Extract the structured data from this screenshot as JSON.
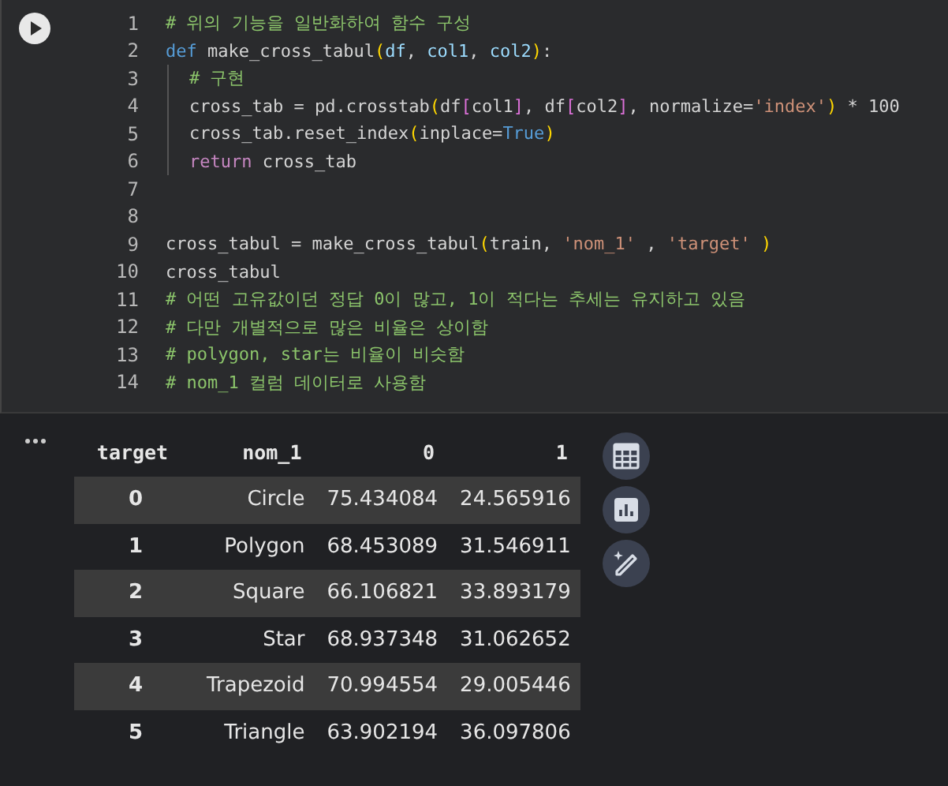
{
  "code_cell": {
    "lines": [
      {
        "number": "1",
        "indented": false,
        "tokens": [
          {
            "t": "# 위의 기능을 일반화하여 함수 구성",
            "kind": "comment"
          }
        ]
      },
      {
        "number": "2",
        "indented": false,
        "tokens": [
          {
            "t": "def",
            "kind": "keyword"
          },
          {
            "t": " make_cross_tabul",
            "kind": "plain"
          },
          {
            "t": "(",
            "kind": "bracket"
          },
          {
            "t": "df",
            "kind": "param"
          },
          {
            "t": ", ",
            "kind": "plain"
          },
          {
            "t": "col1",
            "kind": "param"
          },
          {
            "t": ", ",
            "kind": "plain"
          },
          {
            "t": "col2",
            "kind": "param"
          },
          {
            "t": ")",
            "kind": "bracket"
          },
          {
            "t": ":",
            "kind": "plain"
          }
        ]
      },
      {
        "number": "3",
        "indented": true,
        "tokens": [
          {
            "t": "# 구현",
            "kind": "comment"
          }
        ]
      },
      {
        "number": "4",
        "indented": true,
        "tokens": [
          {
            "t": "cross_tab = pd.crosstab",
            "kind": "plain"
          },
          {
            "t": "(",
            "kind": "bracket"
          },
          {
            "t": "df",
            "kind": "plain"
          },
          {
            "t": "[",
            "kind": "bracket2"
          },
          {
            "t": "col1",
            "kind": "plain"
          },
          {
            "t": "]",
            "kind": "bracket2"
          },
          {
            "t": ", df",
            "kind": "plain"
          },
          {
            "t": "[",
            "kind": "bracket2"
          },
          {
            "t": "col2",
            "kind": "plain"
          },
          {
            "t": "]",
            "kind": "bracket2"
          },
          {
            "t": ", normalize=",
            "kind": "plain"
          },
          {
            "t": "'index'",
            "kind": "string"
          },
          {
            "t": ")",
            "kind": "bracket"
          },
          {
            "t": " * 100",
            "kind": "plain"
          }
        ]
      },
      {
        "number": "5",
        "indented": true,
        "tokens": [
          {
            "t": "cross_tab.reset_index",
            "kind": "plain"
          },
          {
            "t": "(",
            "kind": "bracket"
          },
          {
            "t": "inplace=",
            "kind": "plain"
          },
          {
            "t": "True",
            "kind": "keyword"
          },
          {
            "t": ")",
            "kind": "bracket"
          }
        ]
      },
      {
        "number": "6",
        "indented": true,
        "tokens": [
          {
            "t": "return",
            "kind": "control"
          },
          {
            "t": " cross_tab",
            "kind": "plain"
          }
        ]
      },
      {
        "number": "7",
        "indented": false
      },
      {
        "number": "8",
        "indented": false
      },
      {
        "number": "9",
        "indented": false,
        "tokens": [
          {
            "t": "cross_tabul = make_cross_tabul",
            "kind": "plain"
          },
          {
            "t": "(",
            "kind": "bracket"
          },
          {
            "t": "train, ",
            "kind": "plain"
          },
          {
            "t": "'nom_1'",
            "kind": "string"
          },
          {
            "t": " , ",
            "kind": "plain"
          },
          {
            "t": "'target'",
            "kind": "string"
          },
          {
            "t": " )",
            "kind": "bracket"
          }
        ]
      },
      {
        "number": "10",
        "indented": false,
        "tokens": [
          {
            "t": "cross_tabul",
            "kind": "plain"
          }
        ]
      },
      {
        "number": "11",
        "indented": false,
        "tokens": [
          {
            "t": "# 어떤 고유값이던 정답 0이 많고, 1이 적다는 추세는 유지하고 있음",
            "kind": "comment"
          }
        ]
      },
      {
        "number": "12",
        "indented": false,
        "tokens": [
          {
            "t": "# 다만 개별적으로 많은 비율은 상이함",
            "kind": "comment"
          }
        ]
      },
      {
        "number": "13",
        "indented": false,
        "tokens": [
          {
            "t": "# polygon, star는 비율이 비슷함",
            "kind": "comment"
          }
        ]
      },
      {
        "number": "14",
        "indented": false,
        "tokens": [
          {
            "t": "# nom_1 컬럼 데이터로 사용함",
            "kind": "comment"
          }
        ]
      }
    ]
  },
  "output": {
    "table": {
      "columns": [
        "target",
        "nom_1",
        "0",
        "1"
      ],
      "rows": [
        [
          "0",
          "Circle",
          "75.434084",
          "24.565916"
        ],
        [
          "1",
          "Polygon",
          "68.453089",
          "31.546911"
        ],
        [
          "2",
          "Square",
          "66.106821",
          "33.893179"
        ],
        [
          "3",
          "Star",
          "68.937348",
          "31.062652"
        ],
        [
          "4",
          "Trapezoid",
          "70.994554",
          "29.005446"
        ],
        [
          "5",
          "Triangle",
          "63.902194",
          "36.097806"
        ]
      ]
    }
  }
}
